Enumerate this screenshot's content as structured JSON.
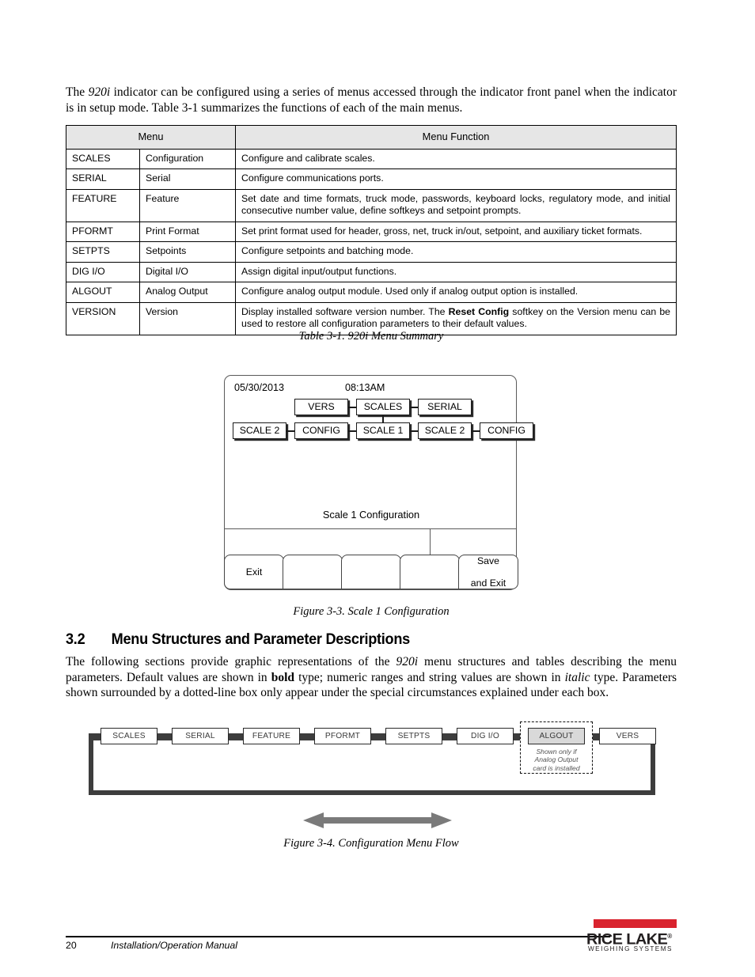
{
  "intro": {
    "text_before_italic": "The ",
    "italic_term": "920i",
    "text_after_italic": " indicator can be configured using a series of menus accessed through the indicator front panel when the indicator is in setup mode. Table 3-1 summarizes the functions of each of the main menus."
  },
  "menu_table": {
    "headers": [
      "Menu",
      "Menu Function"
    ],
    "rows": [
      {
        "key": "SCALES",
        "name": "Configuration",
        "function": "Configure and calibrate scales."
      },
      {
        "key": "SERIAL",
        "name": "Serial",
        "function": "Configure communications ports."
      },
      {
        "key": "FEATURE",
        "name": "Feature",
        "function": "Set date and time formats, truck mode, passwords, keyboard locks, regulatory mode, and initial consecutive number value, define softkeys and setpoint prompts."
      },
      {
        "key": "PFORMT",
        "name": "Print Format",
        "function": "Set print format used for header, gross, net, truck in/out, setpoint, and auxiliary ticket formats."
      },
      {
        "key": "SETPTS",
        "name": "Setpoints",
        "function": "Configure setpoints and batching mode."
      },
      {
        "key": "DIG I/O",
        "name": "Digital I/O",
        "function": "Assign digital input/output functions."
      },
      {
        "key": "ALGOUT",
        "name": "Analog Output",
        "function": "Configure analog output module. Used only if analog output option is installed."
      },
      {
        "key": "VERSION",
        "name": "Version",
        "function_part1": "Display installed software version number. The ",
        "function_bold": "Reset Config",
        "function_part2": " softkey on the Version menu can be used to restore all configuration parameters to their default values."
      }
    ],
    "caption": "Table 3-1. 920i Menu Summary"
  },
  "indicator": {
    "date": "05/30/2013",
    "time": "08:13AM",
    "row1": [
      "VERS",
      "SCALES",
      "SERIAL"
    ],
    "row2": [
      "SCALE 2",
      "CONFIG",
      "SCALE 1",
      "SCALE 2",
      "CONFIG"
    ],
    "title": "Scale 1 Configuration",
    "softkeys": [
      "Exit",
      "",
      "",
      "",
      "Save\nand Exit"
    ],
    "softkey_last_line1": "Save",
    "softkey_last_line2": "and Exit",
    "caption": "Figure 3-3. Scale 1 Configuration"
  },
  "section": {
    "number": "3.2",
    "title": "Menu Structures and Parameter Descriptions",
    "body_p1": "The following sections provide graphic representations of the ",
    "body_italic1": "920i",
    "body_p2": " menu structures and tables describing the menu parameters. Default values are shown in ",
    "body_bold1": "bold",
    "body_p3": " type; numeric ranges and string values are shown in ",
    "body_italic2": "italic",
    "body_p4": " type. Parameters shown surrounded by a dotted-line box only appear under the special circumstances explained under each box."
  },
  "menu_flow": {
    "boxes": [
      {
        "label": "SCALES",
        "gray": false
      },
      {
        "label": "SERIAL",
        "gray": false
      },
      {
        "label": "FEATURE",
        "gray": false
      },
      {
        "label": "PFORMT",
        "gray": false
      },
      {
        "label": "SETPTS",
        "gray": false
      },
      {
        "label": "DIG I/O",
        "gray": false
      },
      {
        "label": "ALGOUT",
        "gray": true
      },
      {
        "label": "VERS",
        "gray": false
      }
    ],
    "note_line1": "Shown only if",
    "note_line2": "Analog Output",
    "note_line3": "card is installed",
    "caption": "Figure 3-4. Configuration Menu Flow",
    "arrow_color": "#7a7a7a",
    "gray_fill": "#d9d9d9"
  },
  "footer": {
    "page_number": "20",
    "manual_title": "Installation/Operation Manual",
    "logo_name": "RICE LAKE",
    "logo_reg": "®",
    "logo_sub": "WEIGHING SYSTEMS",
    "logo_red": "#d9232e"
  }
}
